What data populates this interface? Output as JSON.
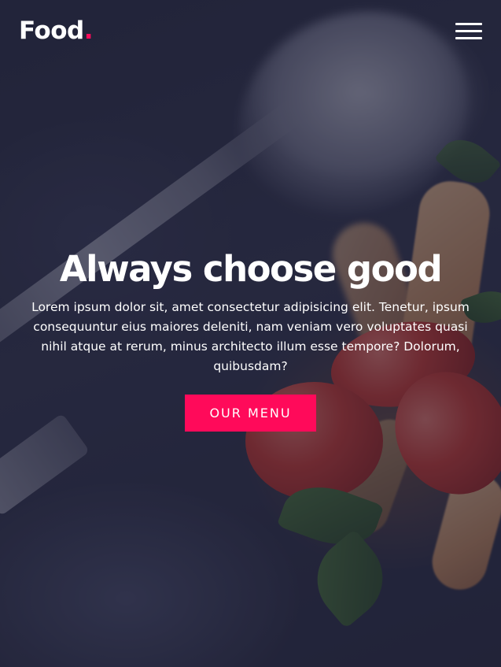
{
  "theme": {
    "accent": "#ff0a5a",
    "overlay": "#1c1e34"
  },
  "header": {
    "logo_text": "Food",
    "logo_dot": ".",
    "menu_icon": "hamburger-menu-icon"
  },
  "hero": {
    "title": "Always choose good",
    "description": "Lorem ipsum dolor sit, amet consectetur adipisicing elit. Tenetur, ipsum consequuntur eius maiores deleniti, nam veniam vero voluptates quasi nihil atque at rerum, minus architecto illum esse tempore? Dolorum, quibusdam?",
    "button_label": "OUR MENU"
  }
}
